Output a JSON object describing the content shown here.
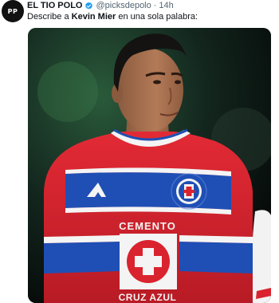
{
  "account": {
    "display_name": "EL TIO POLO",
    "handle": "@picksdepolo",
    "separator": "·",
    "timestamp": "14h",
    "avatar_initials": "PP"
  },
  "tweet": {
    "text_before": "Describe a ",
    "text_bold": "Kevin Mier",
    "text_after": " en una sola palabra:"
  },
  "media": {
    "shirt_sponsor": "CEMENTO",
    "shirt_brand": "CRUZ AZUL",
    "colors": {
      "shirt_red": "#d9232e",
      "shirt_blue": "#1f4fb5",
      "verified_blue": "#1d9bf0"
    }
  }
}
